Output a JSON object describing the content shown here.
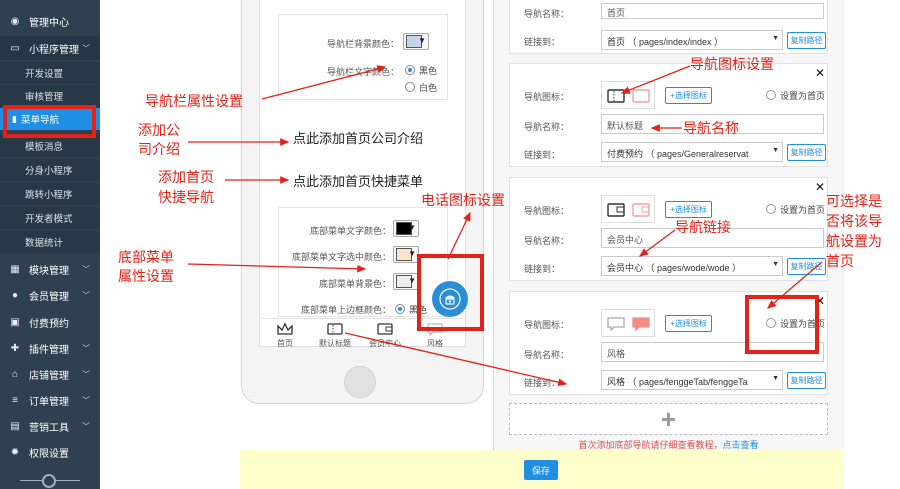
{
  "sidebar": {
    "items": [
      {
        "label": "管理中心",
        "icon": "palette-icon"
      },
      {
        "label": "小程序管理",
        "icon": "monitor-icon",
        "chevron": "﹀"
      },
      {
        "label": "模块管理",
        "icon": "grid-icon",
        "chevron": "﹀"
      },
      {
        "label": "会员管理",
        "icon": "user-icon",
        "chevron": "﹀"
      },
      {
        "label": "付费预约",
        "icon": "card-icon"
      },
      {
        "label": "插件管理",
        "icon": "puzzle-icon",
        "chevron": "﹀"
      },
      {
        "label": "店铺管理",
        "icon": "home-icon",
        "chevron": "﹀"
      },
      {
        "label": "订单管理",
        "icon": "list-icon",
        "chevron": "﹀"
      },
      {
        "label": "营销工具",
        "icon": "briefcase-icon",
        "chevron": "﹀"
      },
      {
        "label": "权限设置",
        "icon": "gear-icon"
      }
    ],
    "subitems": [
      "开发设置",
      "审核管理",
      "菜单导航",
      "模板消息",
      "分身小程序",
      "跳转小程序",
      "开发者模式",
      "数据统计"
    ],
    "active_subitem": "菜单导航"
  },
  "phone": {
    "nav_bg_label": "导航栏背景颜色：",
    "nav_text_label": "导航栏文字颜色：",
    "nav_bg_color": "#c7d3ea",
    "radio_black": "黑色",
    "radio_white": "白色",
    "add_company": "点此添加首页公司介绍",
    "add_shortcut": "点此添加首页快捷菜单",
    "menu_text_label": "底部菜单文字颜色：",
    "menu_selected_label": "底部菜单文字选中颜色：",
    "menu_bg_label": "底部菜单背景色：",
    "menu_border_label": "底部菜单上边框颜色：",
    "menu_text_color": "#000000",
    "menu_selected_color": "#fbe3cc",
    "menu_bg_color": "#eeeeee",
    "menu_border_radio": "黑色",
    "tabs": [
      {
        "label": "首页",
        "icon": "crown-icon"
      },
      {
        "label": "默认标题",
        "icon": "ticket-icon"
      },
      {
        "label": "会员中心",
        "icon": "wallet-icon"
      },
      {
        "label": "风格",
        "icon": "chat-icon"
      }
    ]
  },
  "navcards": [
    {
      "link_label": "链接到：",
      "name_label": "导航名称：",
      "name": "首页",
      "link": "首页 （ pages/index/index ）",
      "copy": "复制路径"
    },
    {
      "icon_label": "导航图标：",
      "name_label": "导航名称：",
      "link_label": "链接到：",
      "name": "默认标题",
      "link": "付费预约 （ pages/Generalreservat",
      "pick": "+选择图标",
      "set_home": "设置为首页",
      "copy": "复制路径"
    },
    {
      "icon_label": "导航图标：",
      "name_label": "导航名称：",
      "link_label": "链接到：",
      "name": "会员中心",
      "link": "会员中心 （ pages/wode/wode ）",
      "pick": "+选择图标",
      "set_home": "设置为首页",
      "copy": "复制路径"
    },
    {
      "icon_label": "导航图标：",
      "name_label": "导航名称：",
      "link_label": "链接到：",
      "name": "风格",
      "link": "风格 （ pages/fenggeTab/fenggeTa",
      "pick": "+选择图标",
      "set_home": "设置为首页",
      "copy": "复制路径"
    }
  ],
  "add_plus": "+",
  "notice": {
    "text": "首次添加底部导航请仔细查看教程，",
    "link": "点击查看"
  },
  "save": "保存",
  "annotations": {
    "nav_attr": "导航栏属性设置",
    "add_company_1": "添加公",
    "add_company_2": "司介绍",
    "add_shortcut_1": "添加首页",
    "add_shortcut_2": "快捷导航",
    "menu_attr_1": "底部菜单",
    "menu_attr_2": "属性设置",
    "phone_icon": "电话图标设置",
    "nav_icon": "导航图标设置",
    "nav_name": "导航名称",
    "nav_link": "导航链接",
    "home_opt_1": "可选择是",
    "home_opt_2": "否将该导",
    "home_opt_3": "航设置为",
    "home_opt_4": "首页"
  },
  "colors": {
    "accent": "#1f8fe3",
    "annotation": "#e2231a",
    "sidebar": "#2f4050"
  }
}
